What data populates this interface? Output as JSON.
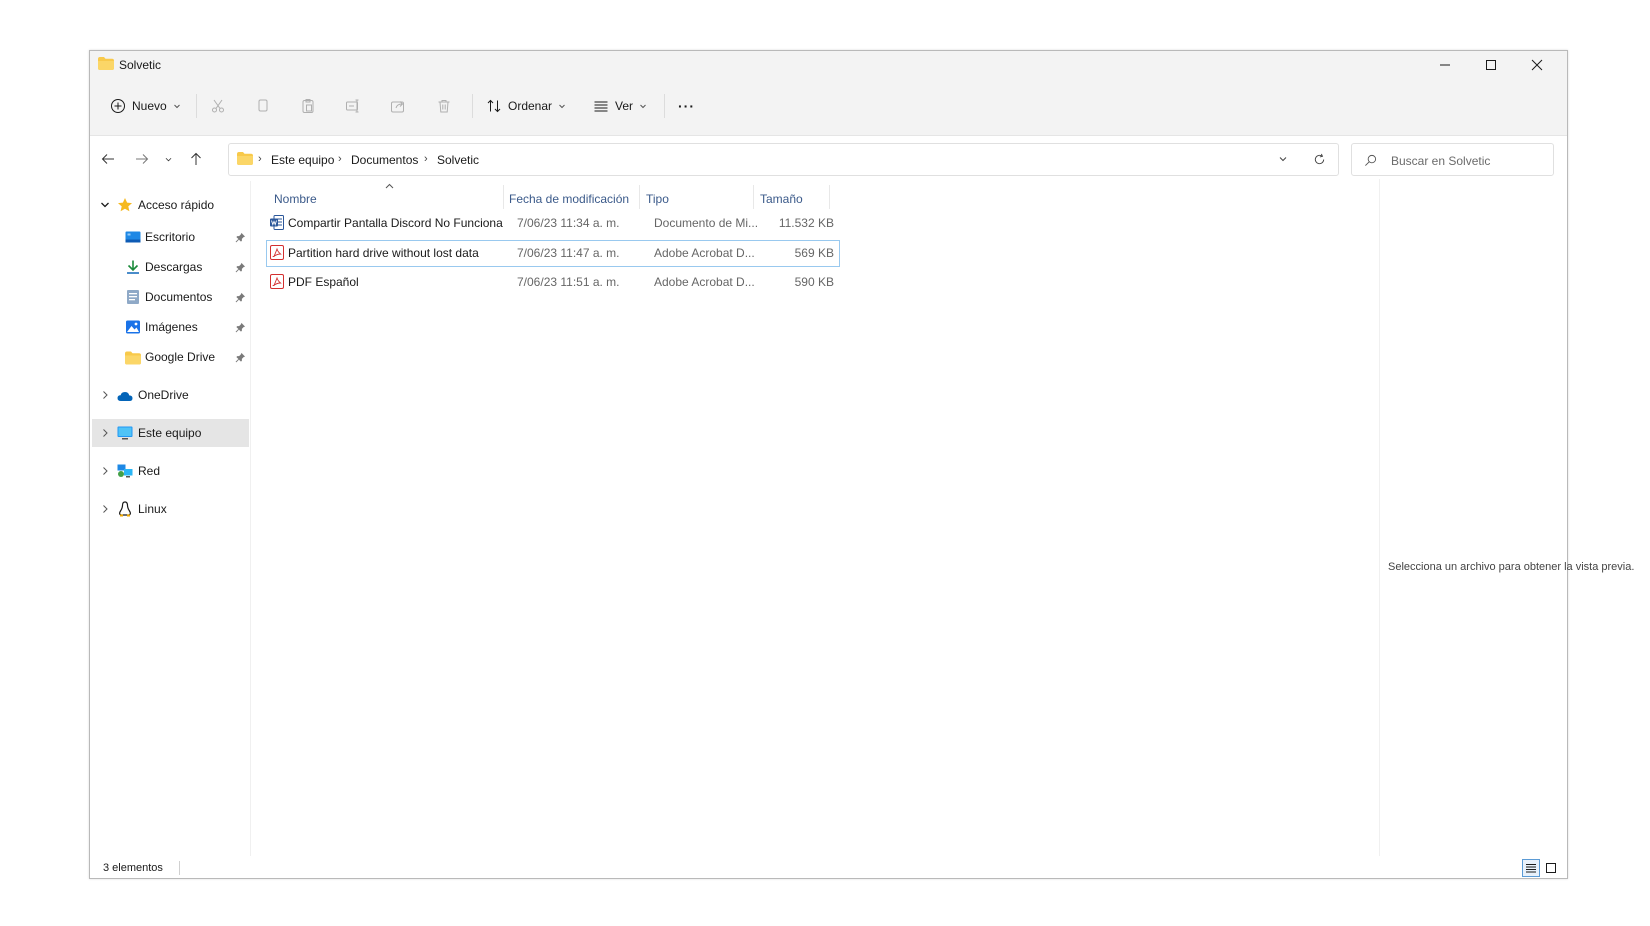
{
  "window": {
    "title": "Solvetic",
    "controls": [
      "minimize",
      "maximize",
      "close"
    ]
  },
  "toolbar": {
    "new_label": "Nuevo",
    "sort_label": "Ordenar",
    "view_label": "Ver",
    "more_label": "···",
    "disabled_actions": [
      "cut",
      "copy",
      "paste",
      "rename",
      "share",
      "delete"
    ]
  },
  "address": {
    "breadcrumb": [
      "Este equipo",
      "Documentos",
      "Solvetic"
    ],
    "search_placeholder": "Buscar en Solvetic"
  },
  "nav": {
    "quick_access": {
      "label": "Acceso rápido",
      "items": [
        {
          "label": "Escritorio",
          "icon": "desktop-icon",
          "pinned": true
        },
        {
          "label": "Descargas",
          "icon": "download-icon",
          "pinned": true
        },
        {
          "label": "Documentos",
          "icon": "documents-icon",
          "pinned": true
        },
        {
          "label": "Imágenes",
          "icon": "pictures-icon",
          "pinned": true
        },
        {
          "label": "Google Drive",
          "icon": "folder-icon",
          "pinned": true
        }
      ]
    },
    "roots": [
      {
        "label": "OneDrive",
        "icon": "cloud-icon",
        "selected": false
      },
      {
        "label": "Este equipo",
        "icon": "computer-icon",
        "selected": true
      },
      {
        "label": "Red",
        "icon": "network-icon",
        "selected": false
      },
      {
        "label": "Linux",
        "icon": "linux-icon",
        "selected": false
      }
    ]
  },
  "files": {
    "columns": [
      "Nombre",
      "Fecha de modificación",
      "Tipo",
      "Tamaño"
    ],
    "sorted_by": "Nombre",
    "rows": [
      {
        "name": "Compartir Pantalla Discord No Funciona",
        "date": "7/06/23 11:34 a. m.",
        "type": "Documento de Mi...",
        "size": "11.532 KB",
        "icon": "word-icon",
        "focused": false
      },
      {
        "name": "Partition hard drive without lost data",
        "date": "7/06/23 11:47 a. m.",
        "type": "Adobe Acrobat D...",
        "size": "569 KB",
        "icon": "pdf-icon",
        "focused": true
      },
      {
        "name": "PDF Español",
        "date": "7/06/23 11:51 a. m.",
        "type": "Adobe Acrobat D...",
        "size": "590 KB",
        "icon": "pdf-icon",
        "focused": false
      }
    ]
  },
  "preview": {
    "message": "Selecciona un archivo para obtener la vista previa."
  },
  "status": {
    "item_count": "3 elementos"
  },
  "colors": {
    "accent": "#0067c0",
    "folder": "#f8c94a",
    "pdf": "#d32f2f",
    "word": "#2b579a",
    "selection_border": "#99c9ef"
  }
}
